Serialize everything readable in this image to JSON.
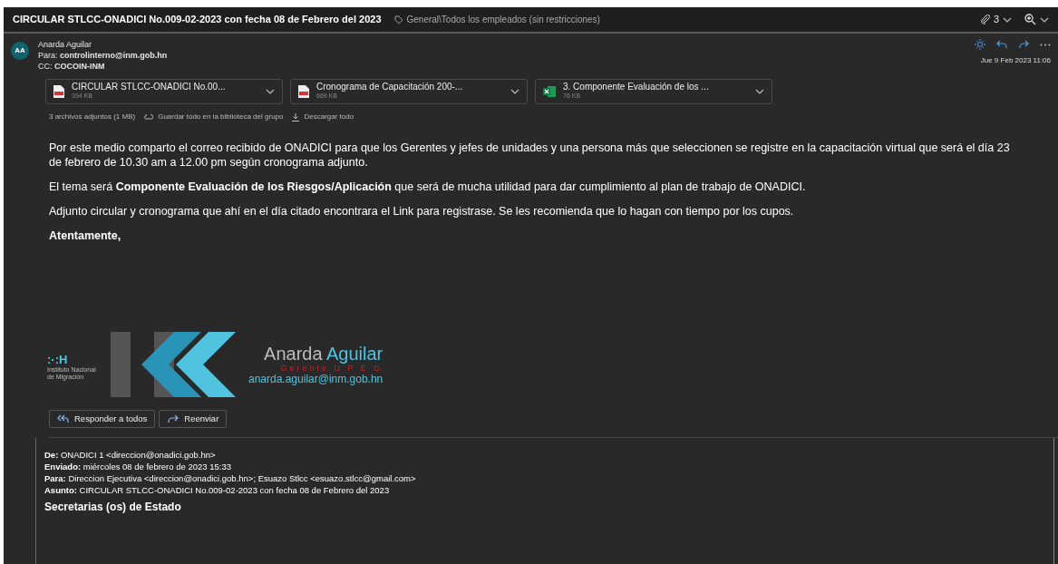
{
  "header": {
    "subject": "CIRCULAR STLCC-ONADICI No.009-02-2023 con fecha 08 de Febrero del 2023",
    "sensitivity": "General\\Todos los empleados (sin restricciones)",
    "attachment_count": "3"
  },
  "message": {
    "avatar": "AA",
    "sender": "Anarda Aguilar",
    "to_label": "Para:",
    "to": "controlinterno@inm.gob.hn",
    "cc_label": "CC:",
    "cc": "COCOIN-INM",
    "date": "Jue 9 Feb 2023 11:06"
  },
  "attachments": [
    {
      "kind": "pdf",
      "name": "CIRCULAR STLCC-ONADICI No.00...",
      "size": "394 KB"
    },
    {
      "kind": "pdf",
      "name": "Cronograma de Capacitación 200-...",
      "size": "669 KB"
    },
    {
      "kind": "excel",
      "name": "3. Componente Evaluación de los ...",
      "size": "76 KB"
    }
  ],
  "attachment_actions": {
    "summary": "3 archivos adjuntos (1 MB)",
    "save": "Guardar todo en la biblioteca del grupo",
    "download": "Descargar todo"
  },
  "body": [
    "Por este medio comparto el correo recibido de ONADICI para que los Gerentes y jefes de unidades y una persona más que seleccionen se registre en la capacitación virtual que será el día 23 de febrero de 10.30 am a 12.00 pm según cronograma adjunto.",
    "El tema será **Componente Evaluación de los Riesgos/Aplicación** que será de mucha utilidad para dar cumplimiento al plan de trabajo de ONADICI.",
    "Adjunto circular y cronograma que ahí en el día citado encontrara el Link para registrase. Se les recomienda que lo hagan con tiempo por los cupos.",
    "Atentamente,"
  ],
  "signature": {
    "logo_mark": ":·:H",
    "institution": "Instituto Nacional de Migración",
    "first_name": "Anarda",
    "last_name": "Aguilar",
    "role": "Gerente U P E G",
    "email": "anarda.aguilar@inm.gob.hn"
  },
  "buttons": [
    {
      "kind": "reply-all",
      "label": "Responder a todos"
    },
    {
      "kind": "forward",
      "label": "Reenviar"
    }
  ],
  "quoted": {
    "fields": [
      "**De:** ONADICI 1 <direccion@onadici.gob.hn>",
      "**Enviado:** miércoles 08 de febrero de 2023 15:33",
      "**Para:** Direccion Ejecutiva <direccion@onadici.gob.hn>; Esuazo Stlcc <esuazo.stlcc@gmail.com>",
      "**Asunto:** CIRCULAR STLCC-ONADICI No.009-02-2023 con fecha 08 de Febrero del 2023"
    ],
    "heading": "Secretarias (os) de Estado"
  }
}
